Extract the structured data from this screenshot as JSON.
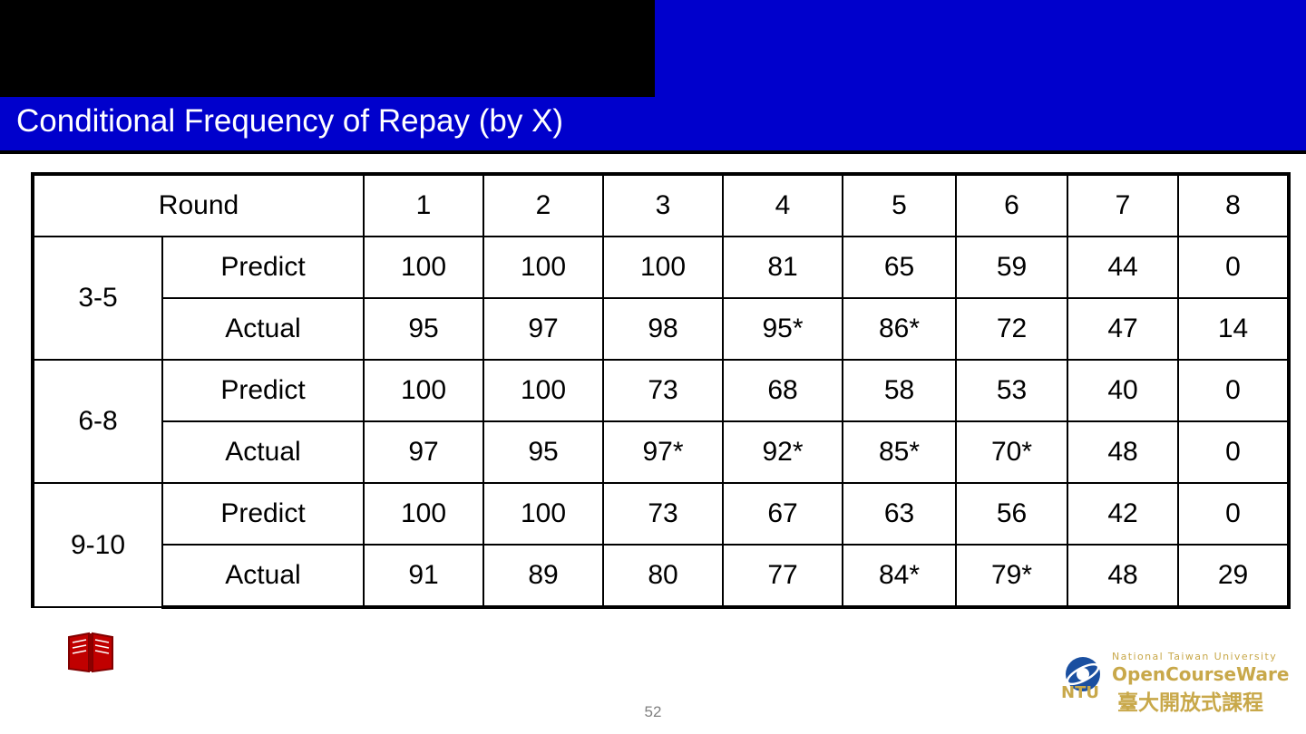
{
  "slide": {
    "title": "Conditional Frequency of Repay (by X)",
    "page_number": "52"
  },
  "table": {
    "corner_label": "Round",
    "column_headers": [
      "1",
      "2",
      "3",
      "4",
      "5",
      "6",
      "7",
      "8"
    ],
    "groups": [
      {
        "label": "3-5",
        "rows": [
          {
            "type": "Predict",
            "values": [
              "100",
              "100",
              "100",
              "81",
              "65",
              "59",
              "44",
              "0"
            ]
          },
          {
            "type": "Actual",
            "values": [
              "95",
              "97",
              "98",
              "95*",
              "86*",
              "72",
              "47",
              "14"
            ]
          }
        ]
      },
      {
        "label": "6-8",
        "rows": [
          {
            "type": "Predict",
            "values": [
              "100",
              "100",
              "73",
              "68",
              "58",
              "53",
              "40",
              "0"
            ]
          },
          {
            "type": "Actual",
            "values": [
              "97",
              "95",
              "97*",
              "92*",
              "85*",
              "70*",
              "48",
              "0"
            ]
          }
        ]
      },
      {
        "label": "9-10",
        "rows": [
          {
            "type": "Predict",
            "values": [
              "100",
              "100",
              "73",
              "67",
              "63",
              "56",
              "42",
              "0"
            ]
          },
          {
            "type": "Actual",
            "values": [
              "91",
              "89",
              "80",
              "77",
              "84*",
              "79*",
              "48",
              "29"
            ]
          }
        ]
      }
    ]
  },
  "footer": {
    "logo_line1": "National Taiwan University",
    "logo_line2": "OpenCourseWare",
    "logo_line3": "臺大開放式課程",
    "logo_ntu": "NTU"
  },
  "colors": {
    "banner_blue": "#0000CC",
    "actual_red": "#FF0000",
    "logo_gold": "#C8A84A"
  }
}
